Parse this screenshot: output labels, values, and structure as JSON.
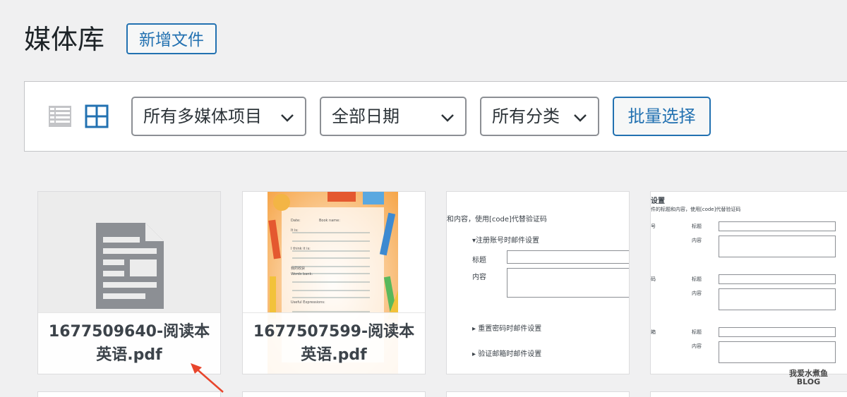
{
  "header": {
    "title": "媒体库",
    "add_new_label": "新增文件"
  },
  "toolbar": {
    "view_modes": [
      "list-view-icon",
      "grid-view-icon"
    ],
    "filter_type": "所有多媒体项目",
    "filter_date": "全部日期",
    "filter_category": "所有分类",
    "bulk_select_label": "批量选择"
  },
  "media": [
    {
      "kind": "document",
      "caption_line1": "1677509640-阅读本",
      "caption_line2": "英语.pdf"
    },
    {
      "kind": "worksheet",
      "caption_line1": "1677507599-阅读本",
      "caption_line2": "英语.pdf",
      "sheet": {
        "date": "Date:",
        "book": "Book name:",
        "it_is": "It is:",
        "i_think": "I think it is:",
        "good_words": "我的收获",
        "words_bank": "Words bank:",
        "useful": "Useful Expressions:"
      }
    },
    {
      "kind": "screenshot",
      "shot": {
        "intro": "和内容，使用[code]代替验证码",
        "section1": "▾注册账号时邮件设置",
        "label_title": "标题",
        "label_content": "内容",
        "section2": "▸ 重置密码时邮件设置",
        "section3": "▸ 验证邮箱时邮件设置"
      }
    },
    {
      "kind": "screenshot",
      "shot": {
        "heading": "设置",
        "intro": "件的标题和内容，使用[code]代替验证码",
        "left1": "号",
        "left2": "码",
        "left3": "箱",
        "label_title": "标题",
        "label_content": "内容"
      }
    }
  ],
  "watermark": {
    "line1": "我爱水煮鱼",
    "line2": "BLOG"
  },
  "colors": {
    "accent": "#2271b1",
    "background": "#f0f0f1",
    "arrow": "#e8452c"
  }
}
